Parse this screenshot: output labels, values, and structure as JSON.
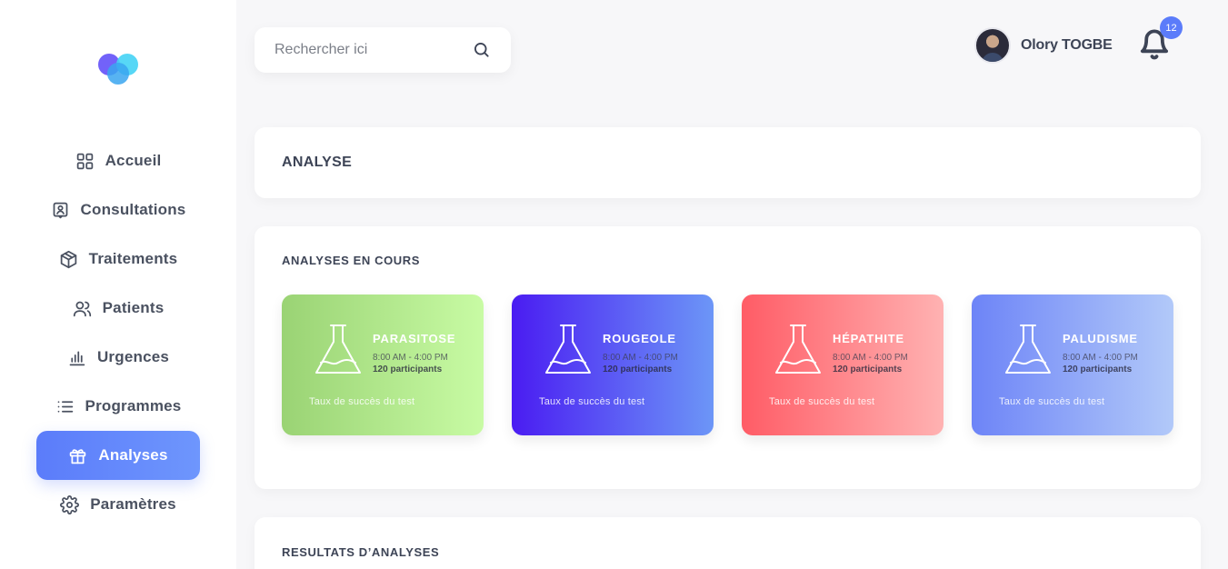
{
  "sidebar": {
    "items": [
      {
        "label": "Accueil",
        "icon": "grid-icon"
      },
      {
        "label": "Consultations",
        "icon": "user-card-icon"
      },
      {
        "label": "Traitements",
        "icon": "box-icon"
      },
      {
        "label": "Patients",
        "icon": "users-icon"
      },
      {
        "label": "Urgences",
        "icon": "bar-chart-icon"
      },
      {
        "label": "Programmes",
        "icon": "list-icon"
      },
      {
        "label": "Analyses",
        "icon": "gift-icon",
        "active": true
      },
      {
        "label": "Paramètres",
        "icon": "gear-icon"
      }
    ],
    "active_color": "#5b7cfa"
  },
  "search": {
    "placeholder": "Rechercher ici"
  },
  "user": {
    "name": "Olory TOGBE"
  },
  "notifications": {
    "count": "12"
  },
  "page": {
    "title": "ANALYSE"
  },
  "current": {
    "title": "ANALYSES EN COURS",
    "cards": [
      {
        "name": "PARASITOSE",
        "time": "8:00 AM - 4:00 PM",
        "participants": "120 participants",
        "rate_label": "Taux de succès du test",
        "colors": [
          "#9ad374",
          "#c8fba4"
        ]
      },
      {
        "name": "ROUGEOLE",
        "time": "8:00 AM - 4:00 PM",
        "participants": "120 participants",
        "rate_label": "Taux de succès du test",
        "colors": [
          "#4a1cf2",
          "#6c96f7"
        ]
      },
      {
        "name": "HÉPATHITE",
        "time": "8:00 AM - 4:00 PM",
        "participants": "120 participants",
        "rate_label": "Taux de succès du test",
        "colors": [
          "#ff5c66",
          "#ffb2b2"
        ]
      },
      {
        "name": "PALUDISME",
        "time": "8:00 AM - 4:00 PM",
        "participants": "120 participants",
        "rate_label": "Taux de succès du test",
        "colors": [
          "#6d84f7",
          "#b2c9f9"
        ]
      }
    ]
  },
  "results": {
    "title": "RESULTATS D’ANALYSES"
  }
}
